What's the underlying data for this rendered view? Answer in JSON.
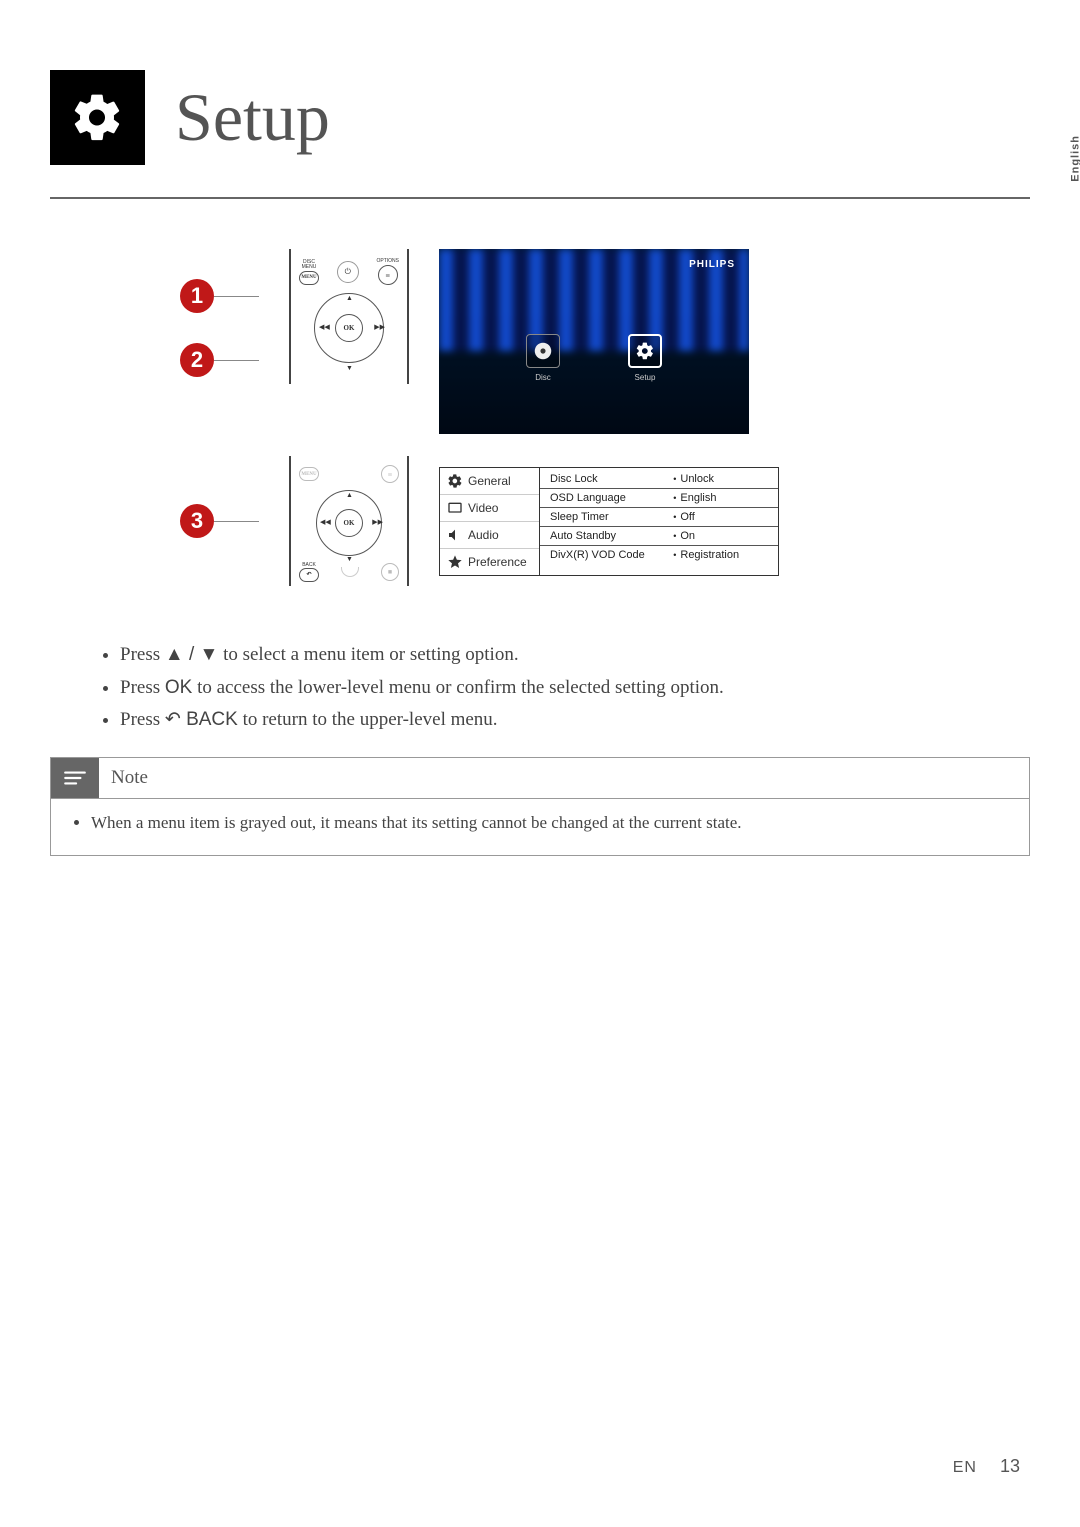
{
  "header": {
    "title": "Setup",
    "lang_tab": "English"
  },
  "steps": {
    "s1": "1",
    "s2": "2",
    "s3": "3"
  },
  "remote": {
    "disc_menu_label": "DISC\nMENU",
    "options_label": "OPTIONS",
    "ok_label": "OK",
    "back_label": "BACK",
    "menu_small": "MENU"
  },
  "tv": {
    "brand": "PHILIPS",
    "icon_disc": "Disc",
    "icon_setup": "Setup"
  },
  "osd": {
    "tabs": {
      "general": "General",
      "video": "Video",
      "audio": "Audio",
      "preference": "Preference"
    },
    "rows": [
      {
        "k": "Disc Lock",
        "v": "Unlock"
      },
      {
        "k": "OSD Language",
        "v": "English"
      },
      {
        "k": "Sleep Timer",
        "v": "Off"
      },
      {
        "k": "Auto Standby",
        "v": "On"
      },
      {
        "k": "DivX(R) VOD Code",
        "v": "Registration"
      }
    ]
  },
  "instructions": {
    "i1_pre": "Press ",
    "i1_arrows": "▲ / ▼",
    "i1_post": " to select a menu item or setting option.",
    "i2_pre": "Press ",
    "i2_ok": "OK",
    "i2_post": " to access the lower-level menu or confirm the selected setting option.",
    "i3_pre": "Press ",
    "i3_back": " BACK",
    "i3_post": " to return to the upper-level menu."
  },
  "note": {
    "title": "Note",
    "body": "When a menu item is grayed out, it means that its setting cannot be changed at the current state."
  },
  "footer": {
    "lang": "EN",
    "page": "13"
  }
}
